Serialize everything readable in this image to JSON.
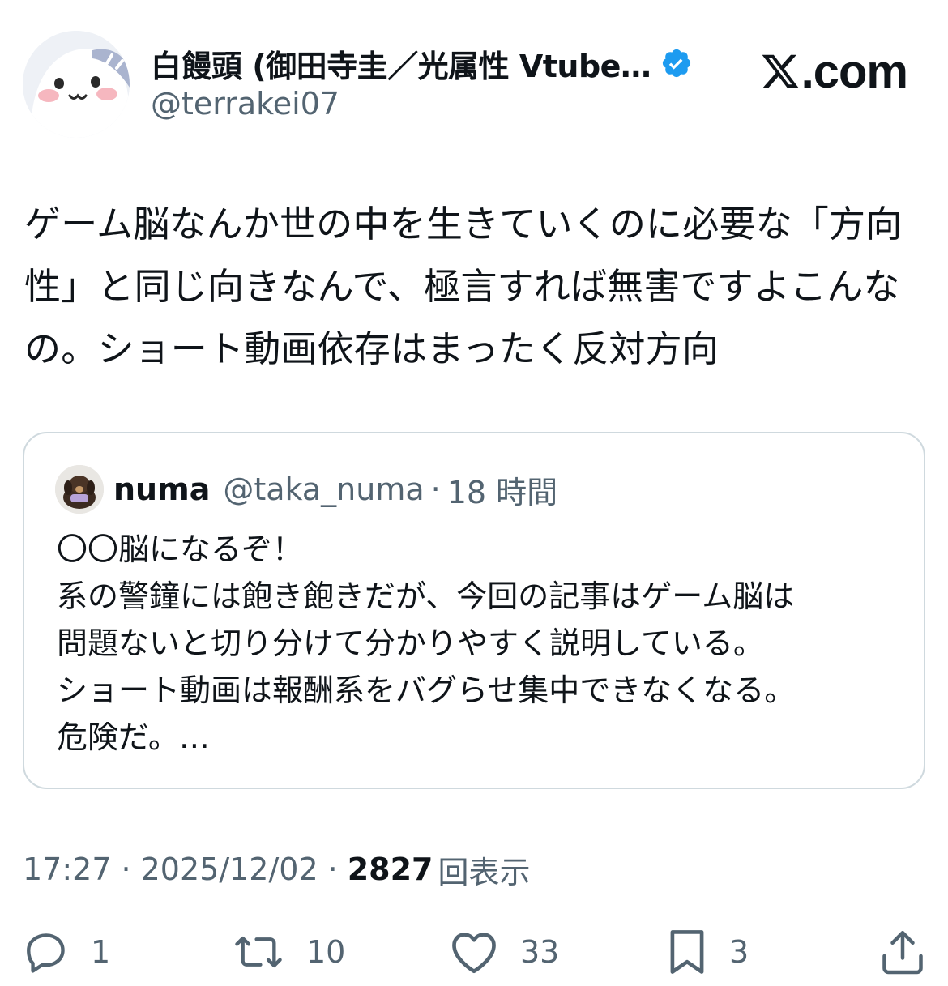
{
  "author": {
    "display_name": "白饅頭 (御田寺圭／光属性 Vtube…",
    "handle": "@terrakei07"
  },
  "site": {
    "label": ".com"
  },
  "tweet": {
    "text": "ゲーム脳なんか世の中を生きていくのに必要な「方向性」と同じ向きなんで、極言すれば無害ですよこんなの。ショート動画依存はまったく反対方向"
  },
  "quote": {
    "name": "numa",
    "handle": "@taka_numa",
    "separator": "·",
    "time": "18 時間",
    "lines": [
      "〇〇脳になるぞ！",
      "系の警鐘には飽き飽きだが、今回の記事はゲーム脳は",
      "問題ないと切り分けて分かりやすく説明している。",
      "ショート動画は報酬系をバグらせ集中できなくなる。",
      "危険だ。…"
    ]
  },
  "meta": {
    "time": "17:27",
    "separator": "·",
    "date": "2025/12/02",
    "views_count": "2827",
    "views_label": "回表示"
  },
  "actions": {
    "replies": "1",
    "reposts": "10",
    "likes": "33",
    "bookmarks": "3"
  },
  "icons": {
    "verified": "verified-badge-icon",
    "x_logo": "x-logo-icon",
    "reply": "reply-icon",
    "repost": "repost-icon",
    "like": "heart-icon",
    "bookmark": "bookmark-icon",
    "share": "share-icon"
  },
  "colors": {
    "text": "#0f1419",
    "secondary": "#536471",
    "verified": "#1d9bf0",
    "border": "#cfd9de"
  }
}
